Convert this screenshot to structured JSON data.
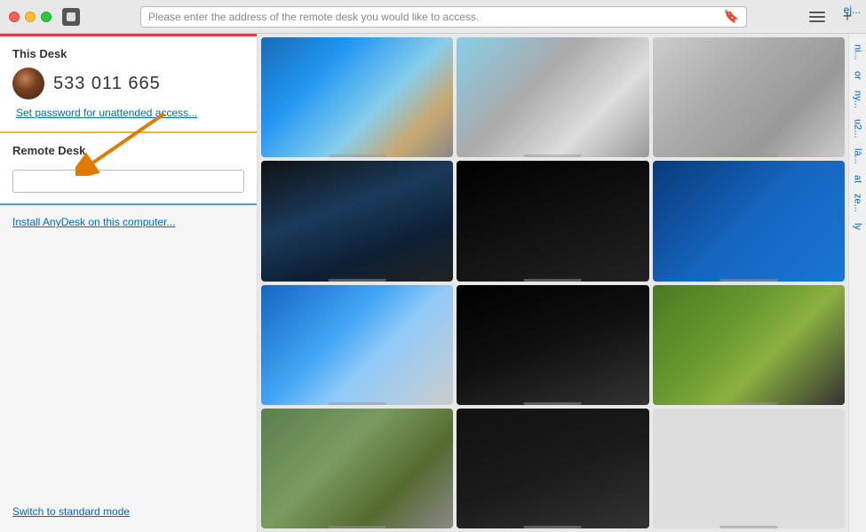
{
  "titlebar": {
    "address_placeholder": "Please enter the address of the remote desk you would like to access.",
    "tab_label": "ej..."
  },
  "sidebar": {
    "this_desk_title": "This Desk",
    "desk_id": "533 011 665",
    "set_password_label": "Set password for unattended access...",
    "remote_desk_title": "Remote Desk",
    "remote_input_placeholder": "",
    "install_label": "Install AnyDesk on this computer...",
    "switch_mode_label": "Switch to standard mode"
  },
  "right_sidebar": {
    "items": [
      "ni...",
      "or",
      "ny...",
      "u2...",
      "lá...",
      "at",
      "ze...",
      "ly"
    ]
  },
  "thumbnails": [
    {
      "id": 1,
      "class": "thumb-1"
    },
    {
      "id": 2,
      "class": "thumb-2"
    },
    {
      "id": 3,
      "class": "thumb-3"
    },
    {
      "id": 4,
      "class": "thumb-4"
    },
    {
      "id": 5,
      "class": "thumb-5"
    },
    {
      "id": 6,
      "class": "thumb-6"
    },
    {
      "id": 7,
      "class": "thumb-7"
    },
    {
      "id": 8,
      "class": "thumb-8"
    },
    {
      "id": 9,
      "class": "thumb-9"
    },
    {
      "id": 10,
      "class": "thumb-10"
    },
    {
      "id": 11,
      "class": "thumb-11"
    },
    {
      "id": 12,
      "class": "thumb-empty"
    }
  ]
}
